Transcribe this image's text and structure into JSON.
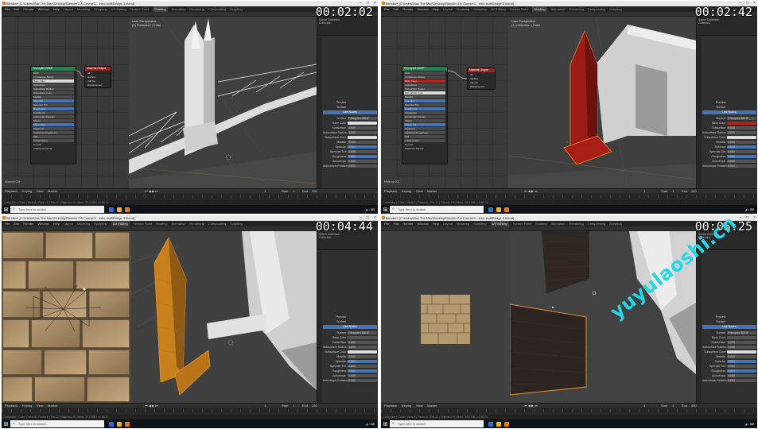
{
  "panels": [
    {
      "timestamp": "00:02:02",
      "window_title": "Blender* [C:\\Users\\Mac The Mac\\Desktop\\Blender 2.8 Course\\1 - intro stuff\\Bridge 3.blend]",
      "left_editor": "node",
      "viewport_label": "User Perspective",
      "viewport_sub": "(1) Collection | Cube",
      "material_name": "Material.003",
      "taskbar_search": "Type here to search"
    },
    {
      "timestamp": "00:02:42",
      "window_title": "Blender* [C:\\Users\\Mac The Mac\\Desktop\\Blender 2.8 Course\\1 - intro stuff\\Bridge 3.blend]",
      "left_editor": "node",
      "viewport_label": "User Perspective",
      "viewport_sub": "(1) Collection | Cube",
      "material_name": "Material.003",
      "taskbar_search": "Type here to search"
    },
    {
      "timestamp": "00:04:44",
      "window_title": "Blender* [C:\\Users\\Mac The Mac\\Desktop\\Blender 2.8 Course\\1 - intro stuff\\Bridge 3.blend]",
      "left_editor": "uv-stone",
      "viewport_label": "User Perspective",
      "viewport_sub": "(1) Collection | Cube",
      "material_name": "Material.003",
      "taskbar_search": "Type here to search"
    },
    {
      "timestamp": "00:05:25",
      "window_title": "Blender* [C:\\Users\\Mac The Mac\\Desktop\\Blender 2.8 Course\\1 - intro stuff\\Bridge 3.blend]",
      "left_editor": "uv-small",
      "viewport_label": "User Perspective",
      "viewport_sub": "(1) Collection | Cube",
      "material_name": "Material.003",
      "taskbar_search": "Type here to search"
    }
  ],
  "menu": {
    "items": [
      "File",
      "Edit",
      "Render",
      "Window",
      "Help"
    ],
    "workspaces": [
      "Layout",
      "Modeling",
      "Sculpting",
      "UV Editing",
      "Texture Paint",
      "Shading",
      "Animation",
      "Rendering",
      "Compositing",
      "Scripting"
    ]
  },
  "node_editor": {
    "bsdf_title": "Principled BSDF",
    "output_title": "Material Output",
    "output_sockets": [
      "All",
      "Surface",
      "Volume",
      "Displacement"
    ],
    "bsdf_rows": [
      "GGX",
      "Christensen-Burley",
      "Base Color",
      "Subsurface",
      "Subsurface Radius",
      "Subsurface Color",
      "Metallic",
      "Specular",
      "Specular Tint",
      "Roughness",
      "Anisotropic",
      "Anisotropic Rotation",
      "Sheen",
      "Sheen Tint",
      "Clearcoat",
      "Clearcoat Roughness",
      "IOR",
      "Transmission",
      "Transmission Roughness",
      "Emission",
      "Alpha",
      "Normal",
      "Clearcoat Normal",
      "Tangent"
    ]
  },
  "properties": {
    "preview": "Preview",
    "surface": "Surface",
    "use_nodes": "Use Nodes",
    "surface_field": "Principled BSDF",
    "rows": [
      {
        "label": "Base Color",
        "value": ""
      },
      {
        "label": "Subsurface",
        "value": "0.000"
      },
      {
        "label": "Subsurface Radius",
        "value": "1.000"
      },
      {
        "label": "Subsurface Color",
        "value": ""
      },
      {
        "label": "Metallic",
        "value": "0.000"
      },
      {
        "label": "Specular",
        "value": "0.500"
      },
      {
        "label": "Specular Tint",
        "value": "0.000"
      },
      {
        "label": "Roughness",
        "value": "0.500"
      },
      {
        "label": "Anisotropic",
        "value": "0.000"
      },
      {
        "label": "Anisotropic Rotation",
        "value": "0.000"
      }
    ],
    "outliner": [
      "Scene Collection",
      "Collection"
    ]
  },
  "timeline": {
    "labels": [
      "Playback",
      "Keying",
      "View",
      "Marker"
    ],
    "frame": "1",
    "start_label": "Start",
    "start": "1",
    "end_label": "End",
    "end": "250"
  },
  "status": "Collection | Cube | Verts:8 | Faces:6 | Tris:12 | Objects:1/9 | Mem: 20.0 MB | v2.80.74",
  "watermark": "yuyulaoshi.cn",
  "colors": {
    "blender_blue": "#4772b3",
    "red_material": "#b3231c",
    "selected_orange": "#e8902a",
    "watermark": "#22d8e6"
  }
}
